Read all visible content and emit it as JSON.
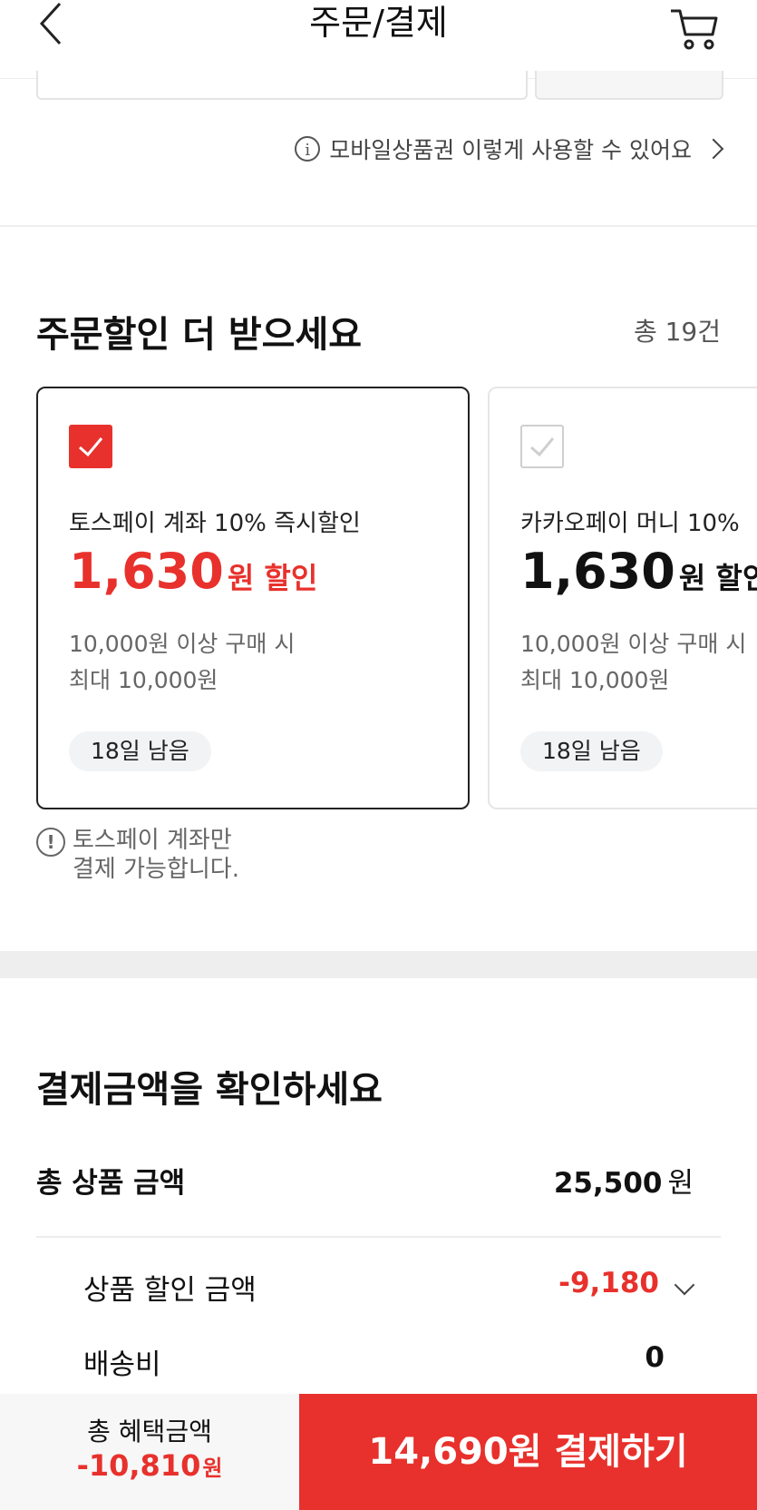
{
  "header": {
    "title": "주문/결제",
    "back_icon": "chevron-left-icon",
    "cart_icon": "cart-icon"
  },
  "coupon": {
    "info_link": "모바일상품권 이렇게 사용할 수 있어요"
  },
  "order_discount": {
    "title": "주문할인 더 받으세요",
    "count": "총 19건",
    "cards": [
      {
        "selected": true,
        "name": "토스페이 계좌 10% 즉시할인",
        "amount": "1,630",
        "amount_unit": "원 할인",
        "condition1": "10,000원 이상 구매 시",
        "condition2": "최대 10,000원",
        "badge": "18일 남음"
      },
      {
        "selected": false,
        "name": "카카오페이 머니 10%",
        "amount": "1,630",
        "amount_unit": "원 할인",
        "condition1": "10,000원 이상 구매 시",
        "condition2": "최대 10,000원",
        "badge": "18일 남음"
      }
    ],
    "note_line1": "토스페이 계좌만",
    "note_line2": "결제 가능합니다."
  },
  "payment": {
    "title": "결제금액을 확인하세요",
    "total_label": "총 상품 금액",
    "total_value": "25,500",
    "won": "원",
    "discount_label": "상품 할인 금액",
    "discount_value": "-9,180",
    "shipping_label": "배송비",
    "shipping_value": "0"
  },
  "bottom_bar": {
    "benefit_label": "총 혜택금액",
    "benefit_value": "-10,810",
    "benefit_unit": "원",
    "pay_button": "14,690원 결제하기"
  },
  "colors": {
    "accent": "#e8312c",
    "text": "#111111",
    "muted": "#666666",
    "divider": "#eeeeee"
  }
}
